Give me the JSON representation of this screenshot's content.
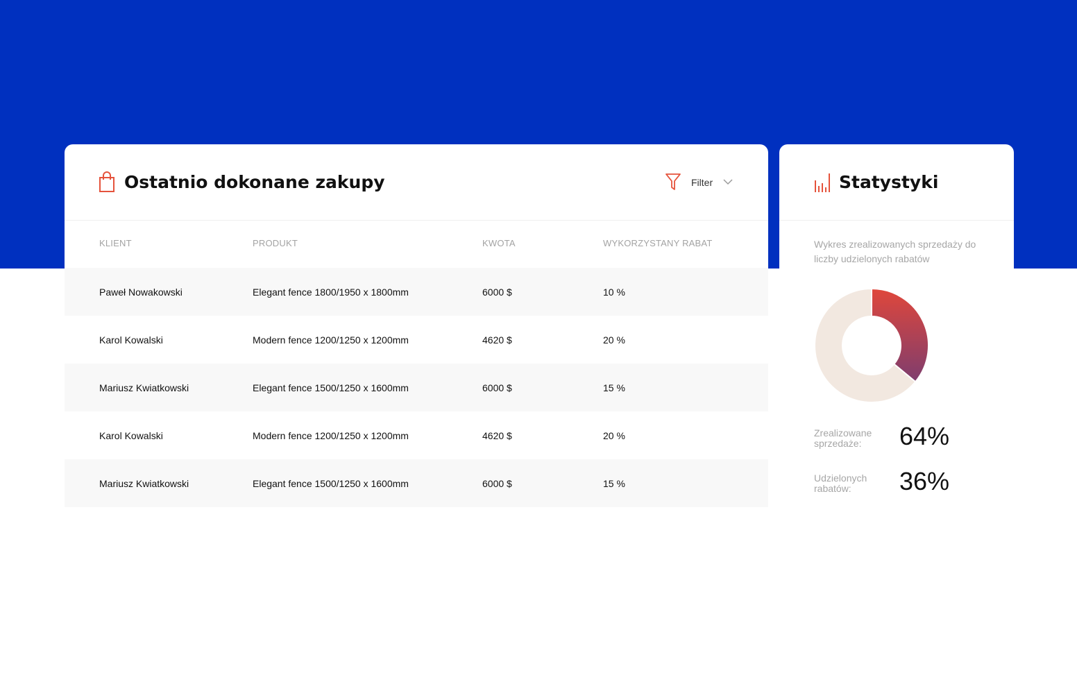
{
  "purchases": {
    "title": "Ostatnio dokonane zakupy",
    "icon": "shopping-bag-icon",
    "filter": {
      "label": "Filter",
      "icon": "filter-icon"
    },
    "columns": [
      "KLIENT",
      "PRODUKT",
      "KWOTA",
      "WYKORZYSTANY RABAT"
    ],
    "rows": [
      {
        "client": "Paweł Nowakowski",
        "product": "Elegant fence 1800/1950 x 1800mm",
        "amount": "6000 $",
        "discount": "10 %"
      },
      {
        "client": "Karol Kowalski",
        "product": "Modern fence 1200/1250 x 1200mm",
        "amount": "4620 $",
        "discount": "20 %"
      },
      {
        "client": "Mariusz Kwiatkowski",
        "product": "Elegant fence 1500/1250 x 1600mm",
        "amount": "6000 $",
        "discount": "15 %"
      },
      {
        "client": "Karol Kowalski",
        "product": "Modern fence 1200/1250 x 1200mm",
        "amount": "4620 $",
        "discount": "20 %"
      },
      {
        "client": "Mariusz Kwiatkowski",
        "product": "Elegant fence 1500/1250 x 1600mm",
        "amount": "6000 $",
        "discount": "15 %"
      }
    ]
  },
  "stats": {
    "title": "Statystyki",
    "icon": "bar-chart-icon",
    "description": "Wykres zrealizowanych sprzedaży do liczby udzielonych rabatów",
    "sales_label": "Zrealizowane sprzedaże:",
    "sales_value": "64%",
    "discounts_label": "Udzielonych rabatów:",
    "discounts_value": "36%"
  },
  "colors": {
    "hero": "#0030bf",
    "accent": "#e5533c",
    "gradient_start": "#e0473b",
    "gradient_end": "#7e3d6e",
    "donut_track": "#f2e8e0"
  },
  "chart_data": {
    "type": "pie",
    "categories": [
      "Zrealizowane sprzedaże",
      "Udzielonych rabatów"
    ],
    "values": [
      64,
      36
    ]
  }
}
